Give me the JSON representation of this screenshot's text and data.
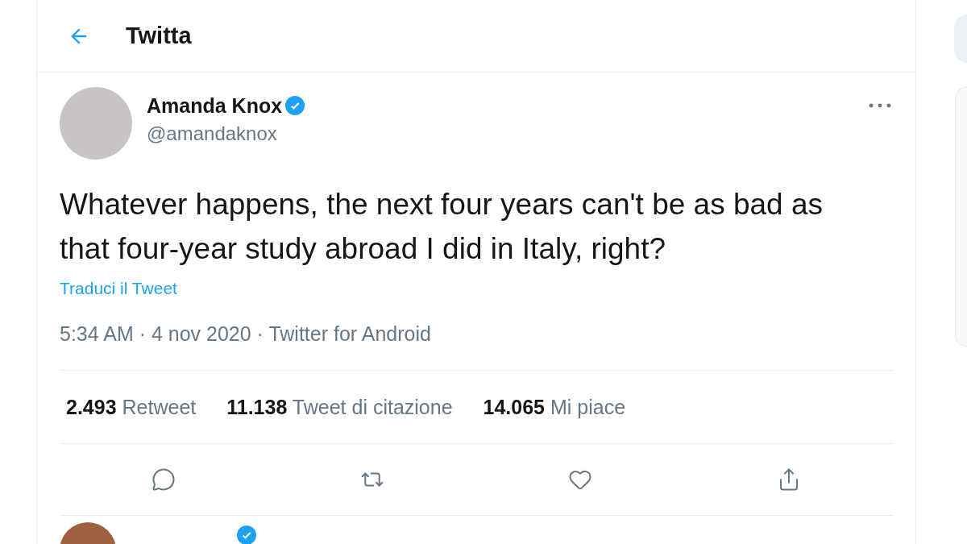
{
  "header": {
    "title": "Twitta"
  },
  "tweet": {
    "author": {
      "name": "Amanda Knox",
      "handle": "@amandaknox",
      "verified": true
    },
    "text": "Whatever happens, the next four years can't be as bad as that four-year study abroad I did in Italy, right?",
    "translate": "Traduci il Tweet",
    "meta": "5:34 AM · 4 nov 2020 · Twitter for Android",
    "stats": [
      {
        "count": "2.493",
        "label": "Retweet"
      },
      {
        "count": "11.138",
        "label": "Tweet di citazione"
      },
      {
        "count": "14.065",
        "label": "Mi piace"
      }
    ],
    "actions": [
      {
        "kind": "reply"
      },
      {
        "kind": "retweet"
      },
      {
        "kind": "like"
      },
      {
        "kind": "share"
      }
    ]
  },
  "next_tweet": {
    "verified": true
  }
}
